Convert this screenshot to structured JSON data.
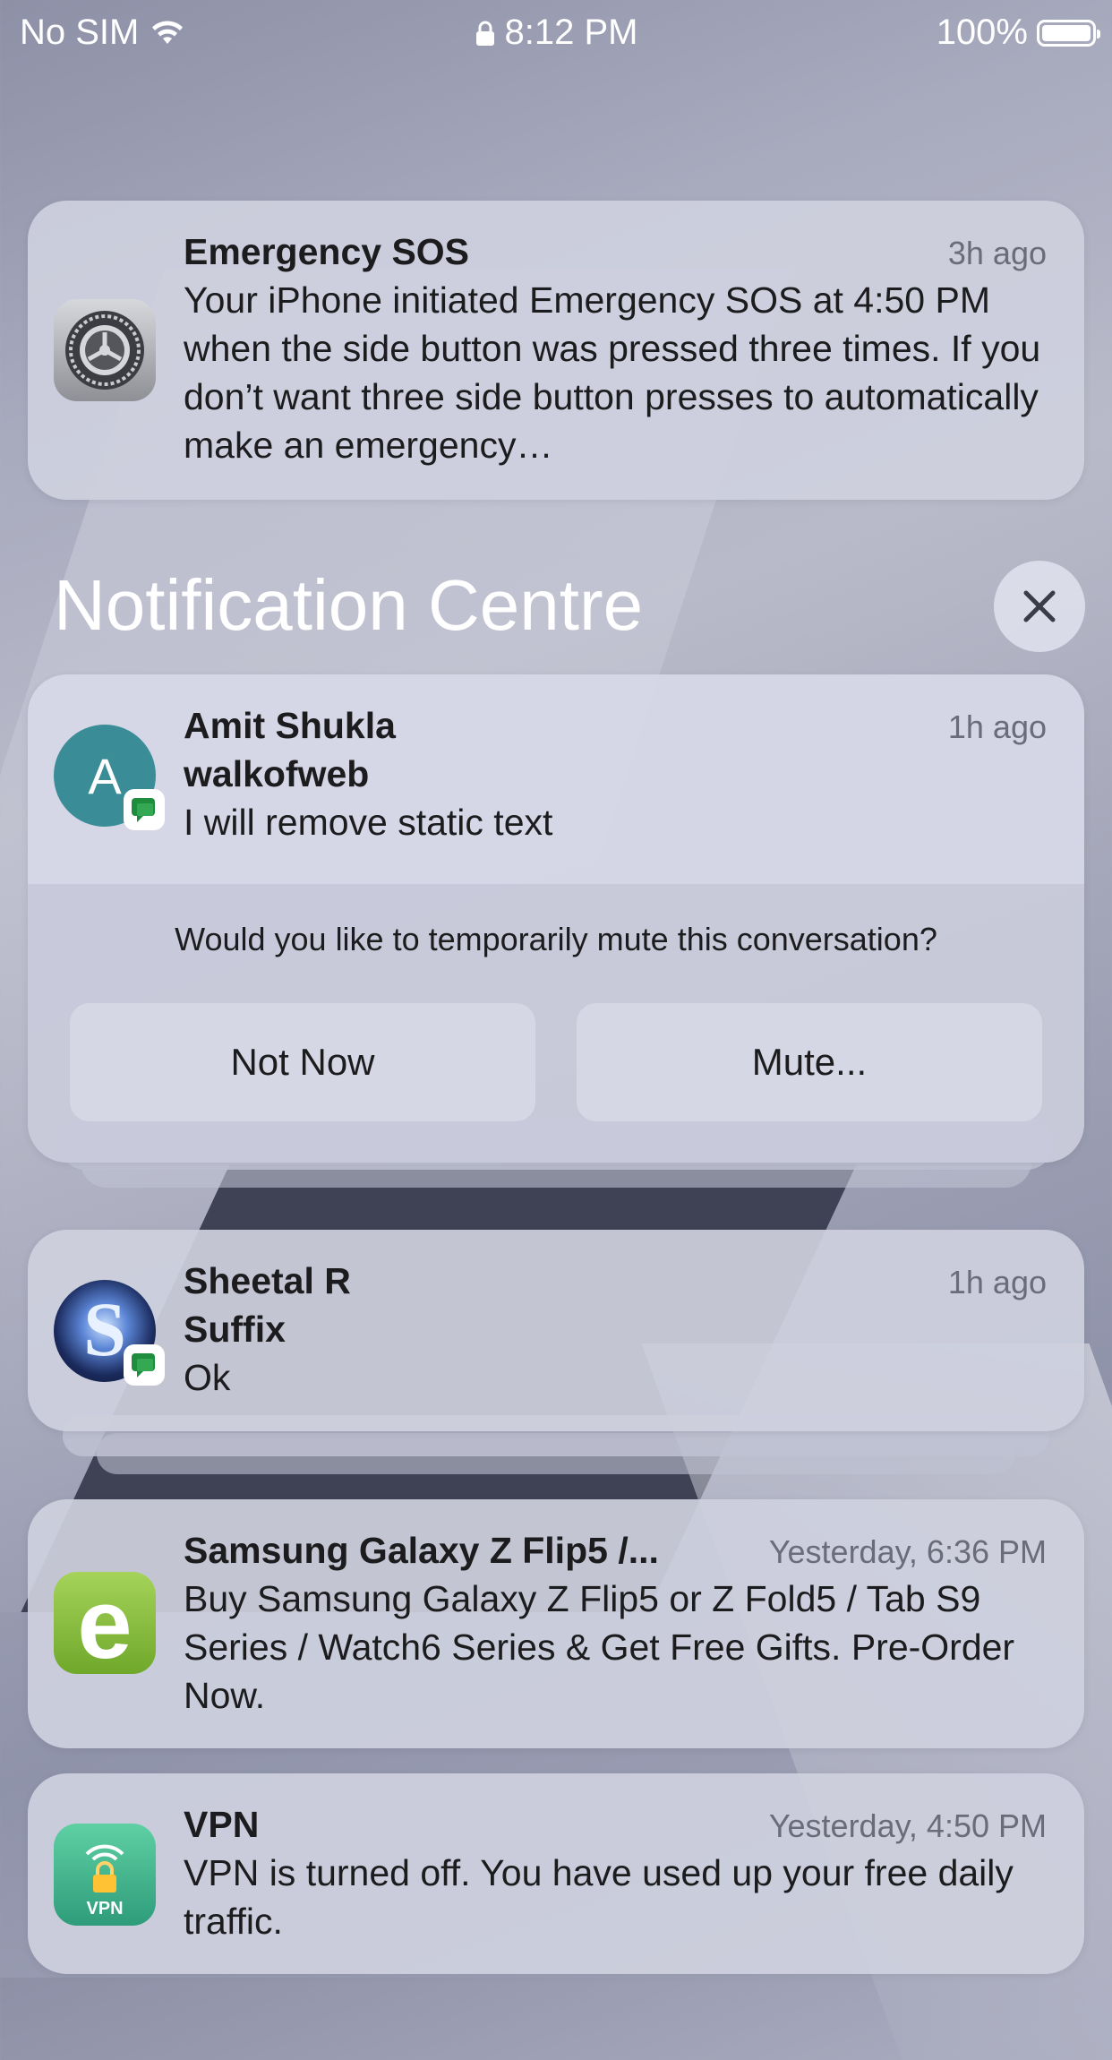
{
  "status_bar": {
    "carrier": "No SIM",
    "time": "8:12 PM",
    "battery": "100%"
  },
  "pinned_notification": {
    "app_icon": "settings-gear-icon",
    "title": "Emergency SOS",
    "time": "3h ago",
    "body": "Your iPhone initiated Emergency SOS at 4:50 PM when the side button was pressed three times. If you don’t want three side button presses to automatically make an emergency…"
  },
  "notification_centre": {
    "header": "Notification Centre",
    "close_icon": "close-x-icon"
  },
  "notifications": [
    {
      "id": "amit",
      "avatar_letter": "A",
      "avatar_color": "#3a8d97",
      "badge_icon": "google-chat-icon",
      "title": "Amit Shukla",
      "subtitle": "walkofweb",
      "time": "1h ago",
      "body": "I will remove static text",
      "mute_prompt": {
        "question": "Would you like to temporarily mute this conversation?",
        "not_now_label": "Not Now",
        "mute_label": "Mute..."
      }
    },
    {
      "id": "sheetal",
      "avatar_icon": "s-logo-avatar",
      "badge_icon": "google-chat-icon",
      "title": "Sheetal R",
      "subtitle": "Suffix",
      "time": "1h ago",
      "body": "Ok"
    },
    {
      "id": "samsung",
      "app_icon": "e-logo-icon",
      "app_color": "#8cc63f",
      "title": "Samsung Galaxy Z Flip5 /...",
      "time": "Yesterday, 6:36 PM",
      "body": "Buy Samsung Galaxy Z Flip5 or Z Fold5 / Tab S9 Series / Watch6 Series & Get Free Gifts. Pre-Order Now."
    },
    {
      "id": "vpn",
      "app_icon": "vpn-lock-icon",
      "app_icon_label": "VPN",
      "app_color": "#3fb58f",
      "title": "VPN",
      "time": "Yesterday, 4:50 PM",
      "body": "VPN is turned off. You have used up your free daily traffic."
    }
  ]
}
